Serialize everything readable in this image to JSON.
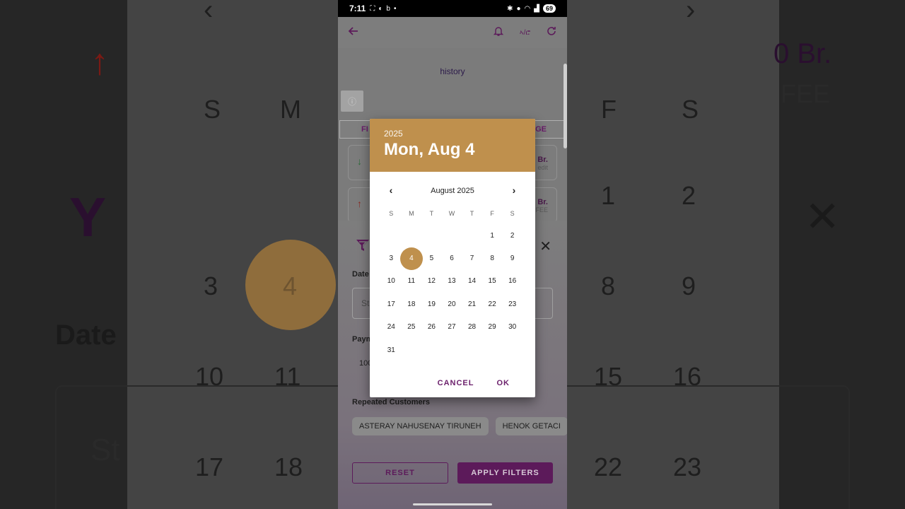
{
  "status_bar": {
    "time": "7:11",
    "battery": "69"
  },
  "app_bar": {
    "translate_label": "ኣ/ሮ"
  },
  "history": {
    "label": "history"
  },
  "tabs": {
    "left_label": "FI",
    "right_label": "GE"
  },
  "cards": [
    {
      "arrow": "↓",
      "amount": "Br.",
      "sub": "edit"
    },
    {
      "arrow": "↑",
      "amount": "Br.",
      "sub": "FEE"
    }
  ],
  "filter_sheet": {
    "date_label": "Date",
    "date_placeholder": "St",
    "payment_label": "Paym",
    "payment_value": "100",
    "repeated_label": "Repeated Customers",
    "chips": [
      "ASTERAY NAHUSENAY TIRUNEH",
      "HENOK GETACI"
    ],
    "reset_label": "RESET",
    "apply_label": "APPLY FILTERS"
  },
  "date_picker": {
    "year": "2025",
    "selected_date": "Mon, Aug 4",
    "month_label": "August 2025",
    "weekdays": [
      "S",
      "M",
      "T",
      "W",
      "T",
      "F",
      "S"
    ],
    "weeks": [
      [
        "",
        "",
        "",
        "",
        "",
        "1",
        "2"
      ],
      [
        "3",
        "4",
        "5",
        "6",
        "7",
        "8",
        "9"
      ],
      [
        "10",
        "11",
        "12",
        "13",
        "14",
        "15",
        "16"
      ],
      [
        "17",
        "18",
        "19",
        "20",
        "21",
        "22",
        "23"
      ],
      [
        "24",
        "25",
        "26",
        "27",
        "28",
        "29",
        "30"
      ],
      [
        "31",
        "",
        "",
        "",
        "",
        "",
        ""
      ]
    ],
    "selected_day": "4",
    "cancel_label": "CANCEL",
    "ok_label": "OK"
  },
  "background": {
    "left_weekdays": [
      "S",
      "M"
    ],
    "right_weekdays": [
      "F",
      "S"
    ],
    "left_rows": [
      [
        "3",
        "4"
      ],
      [
        "10",
        "11"
      ],
      [
        "17",
        "18"
      ]
    ],
    "right_rows": [
      [
        "1",
        "2"
      ],
      [
        "8",
        "9"
      ],
      [
        "15",
        "16"
      ],
      [
        "22",
        "23"
      ]
    ],
    "date_text": "Date",
    "field_text": "St",
    "amount_text": "0 Br.",
    "fee_text": "FEE"
  },
  "colors": {
    "accent": "#bf904d",
    "brand": "#6b1f6b"
  }
}
